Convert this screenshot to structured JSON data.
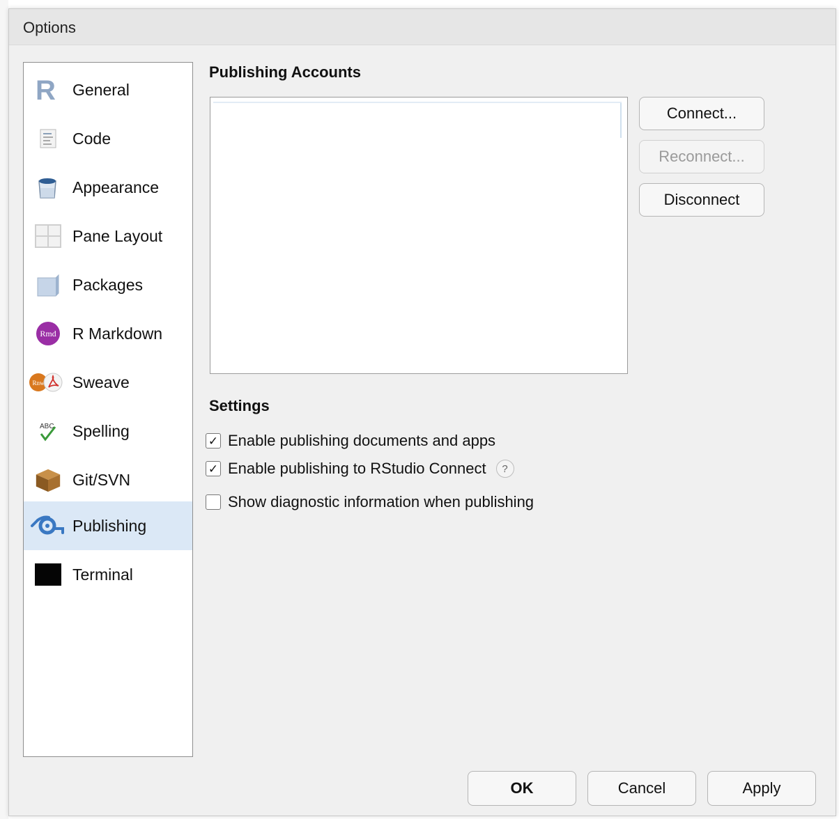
{
  "window": {
    "title": "Options"
  },
  "sidebar": {
    "items": [
      {
        "label": "General",
        "icon": "r-logo-icon"
      },
      {
        "label": "Code",
        "icon": "code-document-icon"
      },
      {
        "label": "Appearance",
        "icon": "paint-bucket-icon"
      },
      {
        "label": "Pane Layout",
        "icon": "pane-layout-icon"
      },
      {
        "label": "Packages",
        "icon": "package-box-icon"
      },
      {
        "label": "R Markdown",
        "icon": "rmd-icon"
      },
      {
        "label": "Sweave",
        "icon": "sweave-pdf-icon"
      },
      {
        "label": "Spelling",
        "icon": "spelling-check-icon"
      },
      {
        "label": "Git/SVN",
        "icon": "git-box-icon"
      },
      {
        "label": "Publishing",
        "icon": "publishing-icon",
        "active": true
      },
      {
        "label": "Terminal",
        "icon": "terminal-icon"
      }
    ]
  },
  "publishing": {
    "accounts_title": "Publishing Accounts",
    "accounts": [],
    "connect_label": "Connect...",
    "reconnect_label": "Reconnect...",
    "disconnect_label": "Disconnect",
    "settings_title": "Settings",
    "options": [
      {
        "label": "Enable publishing documents and apps",
        "checked": true
      },
      {
        "label": "Enable publishing to RStudio Connect",
        "checked": true,
        "help": "?"
      },
      {
        "label": "Show diagnostic information when publishing",
        "checked": false
      }
    ]
  },
  "footer": {
    "ok_label": "OK",
    "cancel_label": "Cancel",
    "apply_label": "Apply"
  },
  "colors": {
    "selected_item_bg": "#dbe8f6",
    "dialog_bg": "#f0f0f0",
    "publishing_icon_blue": "#3a78c2",
    "rmd_purple": "#9a2ea5"
  }
}
